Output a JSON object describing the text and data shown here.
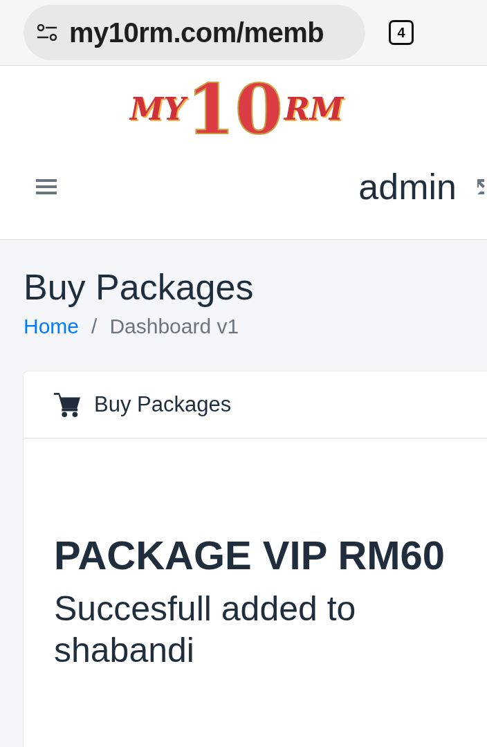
{
  "browser": {
    "url": "my10rm.com/memb",
    "tab_count": "4"
  },
  "header": {
    "logo": {
      "left": "MY",
      "middle": "10",
      "right": "RM"
    },
    "user": "admin"
  },
  "page": {
    "title": "Buy Packages",
    "breadcrumb": [
      "Home",
      "Dashboard v1"
    ],
    "breadcrumb_separator": "/"
  },
  "card": {
    "title": "Buy Packages",
    "heading": "PACKAGE VIP RM60",
    "message": "Succesfull added to shabandi"
  }
}
